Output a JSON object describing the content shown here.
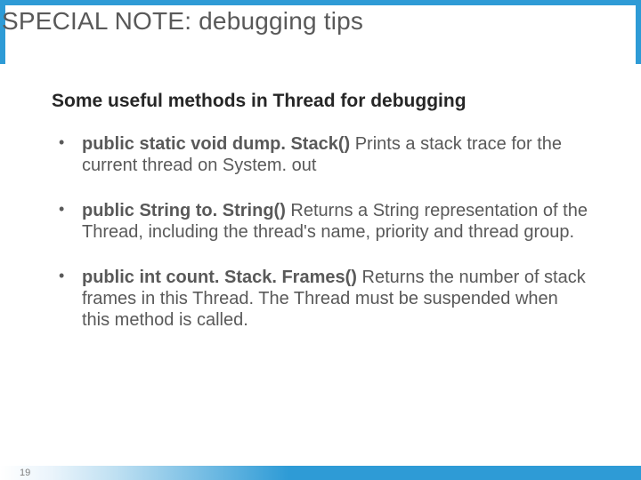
{
  "title": "SPECIAL NOTE:  debugging tips",
  "subhead": "Some useful methods in Thread for debugging",
  "methods": [
    {
      "sig": "public static void dump. Stack() ",
      "desc": "Prints a stack trace for the current thread on System. out"
    },
    {
      "sig": "public String to. String() ",
      "desc": "Returns a String representation of the Thread, including the thread's name, priority and thread group."
    },
    {
      "sig": "public int count. Stack. Frames() ",
      "desc": "Returns the number of stack frames in this Thread. The Thread must be suspended when this method is called."
    }
  ],
  "page_number": "19"
}
